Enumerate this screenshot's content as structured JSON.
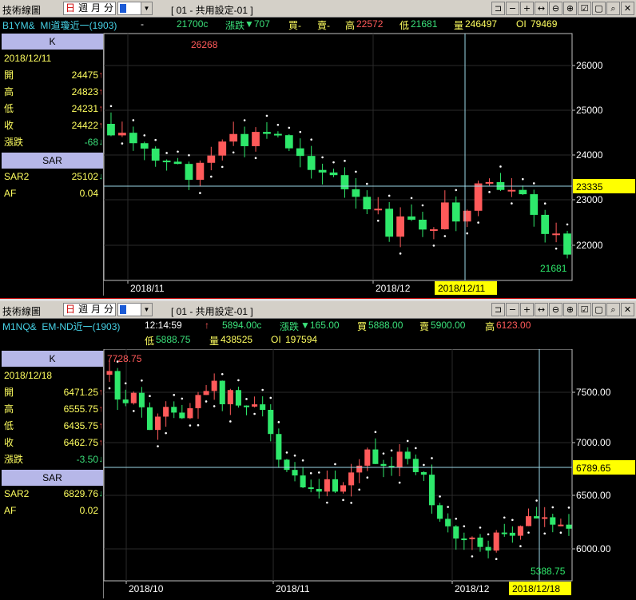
{
  "toolbar": {
    "title": "技術線圖",
    "tab_day": "日",
    "tab_week": "週",
    "tab_month": "月",
    "tab_minute": "分",
    "setting": "[ 01 - 共用設定-01 ]",
    "icons": [
      "pin-icon",
      "minus-icon",
      "plus-icon",
      "left-right-icon",
      "zoom-out-icon",
      "zoom-in-icon",
      "chart-settings-icon",
      "restore-icon",
      "search-icon",
      "close-icon"
    ],
    "icon_glyphs": [
      "⊐",
      "−",
      "+",
      "↔",
      "⊖",
      "⊕",
      "☑",
      "▢",
      "⌕",
      "✕"
    ]
  },
  "panel1": {
    "symbol": "B1YM&  MI道瓊近一(1903)",
    "dash": "-",
    "price": "21700c",
    "change_label": "漲跌",
    "change": "▼707",
    "buy": "買-",
    "sell": "賣-",
    "high_label": "高",
    "high": "22572",
    "low_label": "低",
    "low": "21681",
    "volume_label": "量",
    "volume": "246497",
    "oi_label": "OI",
    "oi": "79469",
    "sidebar": {
      "k_header": "K",
      "date": "2018/12/11",
      "open_label": "開",
      "open": "24475",
      "high_label": "高",
      "high": "24823",
      "low_label": "低",
      "low": "24231",
      "close_label": "收",
      "close": "24422",
      "chg_label": "漲跌",
      "chg": "-68",
      "sar_header": "SAR",
      "sar2_label": "SAR2",
      "sar2": "25102",
      "af_label": "AF",
      "af": "0.04"
    },
    "chart": {
      "y_ticks": [
        "26000",
        "25000",
        "24000",
        "23000",
        "22000"
      ],
      "current_price_label": "23335",
      "max_label": "26268",
      "min_label": "21681",
      "x_labels": [
        "2018/11",
        "2018/12"
      ],
      "cursor_date": "2018/12/11"
    }
  },
  "panel2": {
    "symbol": "M1NQ&  EM-ND近一(1903)",
    "time": "12:14:59",
    "price": "5894.00c",
    "change_label": "漲跌",
    "change": "▼165.00",
    "buy_label": "買",
    "buy": "5888.00",
    "sell_label": "賣",
    "sell": "5900.00",
    "high_label": "高",
    "high": "6123.00",
    "low_label": "低",
    "low": "5888.75",
    "volume_label": "量",
    "volume": "438525",
    "oi_label": "OI",
    "oi": "197594",
    "sidebar": {
      "k_header": "K",
      "date": "2018/12/18",
      "open_label": "開",
      "open": "6471.25",
      "high_label": "高",
      "high": "6555.75",
      "low_label": "低",
      "low": "6435.75",
      "close_label": "收",
      "close": "6462.75",
      "chg_label": "漲跌",
      "chg": "-3.50",
      "sar_header": "SAR",
      "sar2_label": "SAR2",
      "sar2": "6829.76",
      "af_label": "AF",
      "af": "0.02"
    },
    "chart": {
      "y_ticks": [
        "7500.00",
        "7000.00",
        "6500.00",
        "6000.00"
      ],
      "current_price_label": "6789.65",
      "max_label": "7728.75",
      "min_label": "5388.75",
      "x_labels": [
        "2018/10",
        "2018/11",
        "2018/12"
      ],
      "cursor_date": "2018/12/18"
    }
  },
  "colors": {
    "up": "#ff5a5a",
    "down": "#2ee86b",
    "sar": "#ffffff",
    "label_yellow": "#ffff60",
    "cursor_box": "#ffff00",
    "crosshair": "#9bd8e8"
  }
}
